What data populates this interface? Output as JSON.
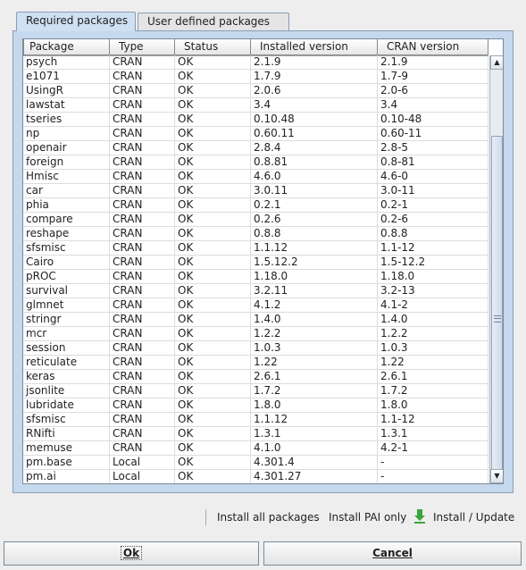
{
  "tabs": [
    {
      "label": "Required packages",
      "active": true
    },
    {
      "label": "User defined packages",
      "active": false
    }
  ],
  "table": {
    "columns": [
      "Package",
      "Type",
      "Status",
      "Installed version",
      "CRAN version"
    ],
    "rows": [
      [
        "psych",
        "CRAN",
        "OK",
        "2.1.9",
        "2.1.9"
      ],
      [
        "e1071",
        "CRAN",
        "OK",
        "1.7.9",
        "1.7-9"
      ],
      [
        "UsingR",
        "CRAN",
        "OK",
        "2.0.6",
        "2.0-6"
      ],
      [
        "lawstat",
        "CRAN",
        "OK",
        "3.4",
        "3.4"
      ],
      [
        "tseries",
        "CRAN",
        "OK",
        "0.10.48",
        "0.10-48"
      ],
      [
        "np",
        "CRAN",
        "OK",
        "0.60.11",
        "0.60-11"
      ],
      [
        "openair",
        "CRAN",
        "OK",
        "2.8.4",
        "2.8-5"
      ],
      [
        "foreign",
        "CRAN",
        "OK",
        "0.8.81",
        "0.8-81"
      ],
      [
        "Hmisc",
        "CRAN",
        "OK",
        "4.6.0",
        "4.6-0"
      ],
      [
        "car",
        "CRAN",
        "OK",
        "3.0.11",
        "3.0-11"
      ],
      [
        "phia",
        "CRAN",
        "OK",
        "0.2.1",
        "0.2-1"
      ],
      [
        "compare",
        "CRAN",
        "OK",
        "0.2.6",
        "0.2-6"
      ],
      [
        "reshape",
        "CRAN",
        "OK",
        "0.8.8",
        "0.8.8"
      ],
      [
        "sfsmisc",
        "CRAN",
        "OK",
        "1.1.12",
        "1.1-12"
      ],
      [
        "Cairo",
        "CRAN",
        "OK",
        "1.5.12.2",
        "1.5-12.2"
      ],
      [
        "pROC",
        "CRAN",
        "OK",
        "1.18.0",
        "1.18.0"
      ],
      [
        "survival",
        "CRAN",
        "OK",
        "3.2.11",
        "3.2-13"
      ],
      [
        "glmnet",
        "CRAN",
        "OK",
        "4.1.2",
        "4.1-2"
      ],
      [
        "stringr",
        "CRAN",
        "OK",
        "1.4.0",
        "1.4.0"
      ],
      [
        "mcr",
        "CRAN",
        "OK",
        "1.2.2",
        "1.2.2"
      ],
      [
        "session",
        "CRAN",
        "OK",
        "1.0.3",
        "1.0.3"
      ],
      [
        "reticulate",
        "CRAN",
        "OK",
        "1.22",
        "1.22"
      ],
      [
        "keras",
        "CRAN",
        "OK",
        "2.6.1",
        "2.6.1"
      ],
      [
        "jsonlite",
        "CRAN",
        "OK",
        "1.7.2",
        "1.7.2"
      ],
      [
        "lubridate",
        "CRAN",
        "OK",
        "1.8.0",
        "1.8.0"
      ],
      [
        "sfsmisc",
        "CRAN",
        "OK",
        "1.1.12",
        "1.1-12"
      ],
      [
        "RNifti",
        "CRAN",
        "OK",
        "1.3.1",
        "1.3.1"
      ],
      [
        "memuse",
        "CRAN",
        "OK",
        "4.1.0",
        "4.2-1"
      ],
      [
        "pm.base",
        "Local",
        "OK",
        "4.301.4",
        "-"
      ],
      [
        "pm.ai",
        "Local",
        "OK",
        "4.301.27",
        "-"
      ]
    ]
  },
  "actions": {
    "install_all": "Install all packages",
    "install_pai": "Install PAI only",
    "install_update": "Install / Update",
    "install_update_icon": "download-arrow-icon"
  },
  "buttons": {
    "ok": "Ok",
    "cancel": "Cancel"
  },
  "colors": {
    "panel": "#c6d8ee",
    "active_tab": "#cfe0f3",
    "icon_green": "#3aa63a"
  }
}
